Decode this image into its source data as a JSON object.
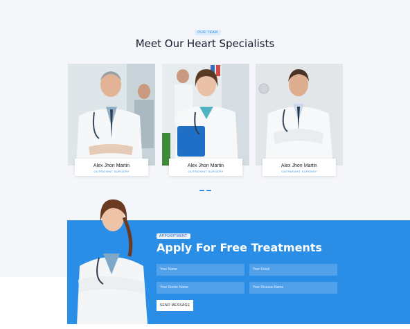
{
  "team": {
    "tag": "OUR TEAM",
    "title": "Meet Our Heart Specialists",
    "members": [
      {
        "name": "Alex Jhon Martin",
        "role": "OUTPATIENT SURGERY"
      },
      {
        "name": "Alex Jhon Martin",
        "role": "OUTPATIENT SURGERY"
      },
      {
        "name": "Alex Jhon Martin",
        "role": "OUTPATIENT SURGERY"
      }
    ]
  },
  "appointment": {
    "tag": "APPOINTMENT",
    "title": "Apply For Free Treatments",
    "fields": {
      "name": "Your Name",
      "email": "Your Email",
      "doctor": "Your Doctor Name",
      "disease": "Your Disease Name"
    },
    "submit_label": "SEND MESSAGE"
  },
  "colors": {
    "accent": "#2a8de6",
    "section_bg": "#f5f6fa"
  }
}
